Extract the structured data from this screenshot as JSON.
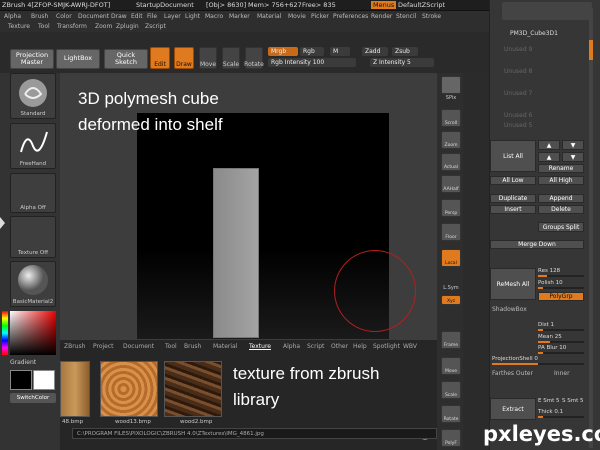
{
  "topbar": {
    "app": "ZBrush 4[ZFOP-SMJK-AWRJ-DFOT]",
    "doc": "StartupDocument",
    "obj": "[Obj> 8630]",
    "mem": "Mem> 756+627",
    "free": "Free> 835",
    "menus": "Menus",
    "script": "DefaultZScript"
  },
  "menubar": {
    "row1": [
      "Alpha",
      "Brush",
      "Color",
      "Document",
      "Draw",
      "Edit",
      "File",
      "Layer",
      "Light",
      "Macro",
      "Marker",
      "Material",
      "Movie",
      "Picker",
      "Preferences",
      "Render",
      "Stencil",
      "Stroke"
    ],
    "row2": [
      "Texture",
      "Tool",
      "Transform",
      "Zoom",
      "Zplugin",
      "Zscript"
    ]
  },
  "toolbar": {
    "projection_master": "Projection Master",
    "lightbox": "LightBox",
    "quick_sketch": "Quick Sketch",
    "edit": "Edit",
    "draw": "Draw",
    "move": "Move",
    "scale": "Scale",
    "rotate": "Rotate",
    "mrgb": "Mrgb",
    "rgb": "Rgb",
    "m": "M",
    "zadd": "Zadd",
    "zsub": "Zsub",
    "rgb_intensity": "Rgb Intensity 100",
    "z_intensity": "Z Intensity 5"
  },
  "leftshelf": {
    "standard": "Standard",
    "freehand": "FreeHand",
    "alpha_off": "Alpha Off",
    "texture_off": "Texture Off",
    "material": "BasicMaterial2",
    "gradient": "Gradient",
    "switch_color": "SwitchColor"
  },
  "viewport": {
    "caption_top": "3D polymesh cube\ndeformed into shelf",
    "caption_bottom": "texture from zbrush\nlibrary"
  },
  "rightbar": [
    "SPix",
    "Scroll",
    "Zoom",
    "Actual",
    "AAHalf",
    "Persp",
    "Floor",
    "Local",
    "L.Sym",
    "Xyz",
    "Frame",
    "Move",
    "Scale",
    "Rotate",
    "PolyF"
  ],
  "tray": {
    "tool_name": "PM3D_Cube3D1",
    "unused": [
      "Unused 9",
      "Unused 8",
      "Unused 7",
      "Unused 6",
      "Unused 5"
    ],
    "list_all": "List All",
    "rename": "Rename",
    "all_low": "All Low",
    "all_high": "All High",
    "duplicate": "Duplicate",
    "append": "Append",
    "insert": "Insert",
    "delete": "Delete",
    "groups_split": "Groups Split",
    "merge_down": "Merge Down",
    "res": "Res 128",
    "polish": "Polish 10",
    "remesh_all": "ReMesh All",
    "polygrp": "PolyGrp",
    "shadowbox": "ShadowBox",
    "dist": "Dist 1",
    "mean": "Mean 25",
    "pa_blur": "PA Blur 10",
    "projection_shell": "ProjectionShell 0",
    "farthest": "Farthes Outer",
    "inner": "Inner",
    "extract": "Extract",
    "e_smt": "E Smt 5",
    "s_smt": "S Smt 5",
    "thick": "Thick 0.1"
  },
  "texpanel": {
    "tabs": [
      "ZBrush",
      "Project",
      "Document",
      "Tool",
      "Brush",
      "Material",
      "Texture",
      "Alpha",
      "Script",
      "Other",
      "Help",
      "Spotlight",
      "WBV"
    ],
    "active_tab": "Texture",
    "thumbs": [
      "48.bmp",
      "wood13.bmp",
      "wood2.bmp"
    ],
    "path": "C:\\PROGRAM FILES\\PIXOLOGIC\\ZBRUSH 4.0\\ZTextures\\IMG_4861.jpg"
  },
  "watermark": "pxleyes.com",
  "colors": {
    "accent": "#e07a1e",
    "background": "#2b2b2b",
    "panel": "#363636"
  }
}
